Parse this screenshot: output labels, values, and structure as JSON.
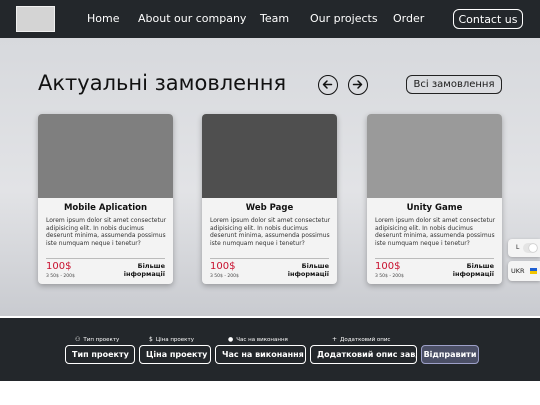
{
  "header": {
    "nav": [
      "Home",
      "About our company",
      "Team",
      "Our projects",
      "Order"
    ],
    "contact_label": "Contact us"
  },
  "main": {
    "title": "Актуальні замовлення",
    "prev_icon": "arrow-left-icon",
    "next_icon": "arrow-right-icon",
    "all_orders_label": "Всі замовлення",
    "cards": [
      {
        "title": "Mobile Aplication",
        "image_color": "#7f7f7f",
        "description": "Lorem ipsum dolor sit amet consectetur adipisicing elit. In nobis ducimus deserunt minima, assumenda possimus iste numquam neque i tenetur?",
        "price": "100$",
        "range": "3 50$ - 200$",
        "more_label": "Більше інформації"
      },
      {
        "title": "Web Page",
        "image_color": "#4f4f4f",
        "description": "Lorem ipsum dolor sit amet consectetur adipisicing elit. In nobis ducimus deserunt minima, assumenda possimus iste numquam neque i tenetur?",
        "price": "100$",
        "range": "3 50$ - 200$",
        "more_label": "Більше інформації"
      },
      {
        "title": "Unity Game",
        "image_color": "#9a9a9a",
        "description": "Lorem ipsum dolor sit amet consectetur adipisicing elit. In nobis ducimus deserunt minima, assumenda possimus iste numquam neque i tenetur?",
        "price": "100$",
        "range": "3 50$ - 200$",
        "more_label": "Більше інформації"
      }
    ]
  },
  "side": {
    "theme_label": "L",
    "lang_label": "UKR"
  },
  "order_form": {
    "fields": [
      {
        "label": "Тип проекту",
        "icon": "project-type-icon",
        "value": "Тип проекту"
      },
      {
        "label": "Ціна проекту",
        "icon": "dollar-icon",
        "value": "Ціна проекту"
      },
      {
        "label": "Час на виконання",
        "icon": "clock-icon",
        "value": "Час на виконання"
      },
      {
        "label": "Додатковий опис",
        "icon": "plus-icon",
        "value": "Додатковий опис завдання"
      }
    ],
    "submit_label": "Відправити"
  },
  "colors": {
    "header_bg": "#23272b",
    "price": "#c8102e",
    "submit_bg": "#4b4f66"
  }
}
